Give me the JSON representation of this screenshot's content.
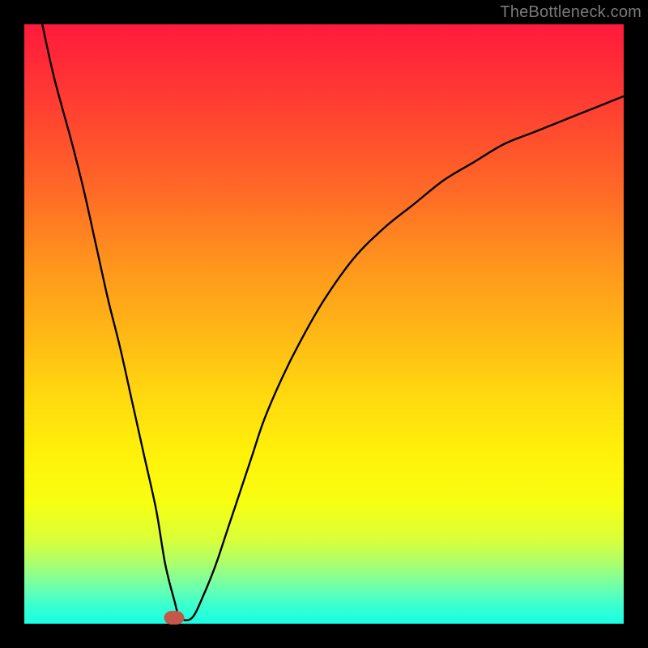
{
  "watermark": "TheBottleneck.com",
  "colors": {
    "background": "#000000",
    "curve": "#000000",
    "marker": "#c5564a"
  },
  "chart_data": {
    "type": "line",
    "title": "",
    "xlabel": "",
    "ylabel": "",
    "xlim": [
      0,
      100
    ],
    "ylim": [
      0,
      100
    ],
    "grid": false,
    "legend": false,
    "x": [
      3,
      5,
      8,
      10,
      12,
      14,
      16,
      18,
      20,
      22,
      23.5,
      25,
      26,
      28,
      30,
      32,
      34,
      36,
      38,
      40,
      43,
      46,
      50,
      55,
      60,
      65,
      70,
      75,
      80,
      85,
      90,
      95,
      100
    ],
    "values": [
      100,
      91,
      80,
      72,
      63,
      54,
      46,
      37,
      28,
      19,
      10,
      4,
      1,
      1,
      5,
      10,
      16,
      22,
      28,
      34,
      41,
      47,
      54,
      61,
      66,
      70,
      74,
      77,
      80,
      82,
      84,
      86,
      88
    ],
    "marker": {
      "x": 25,
      "y": 1,
      "rx": 1.7,
      "ry": 1.2
    }
  }
}
